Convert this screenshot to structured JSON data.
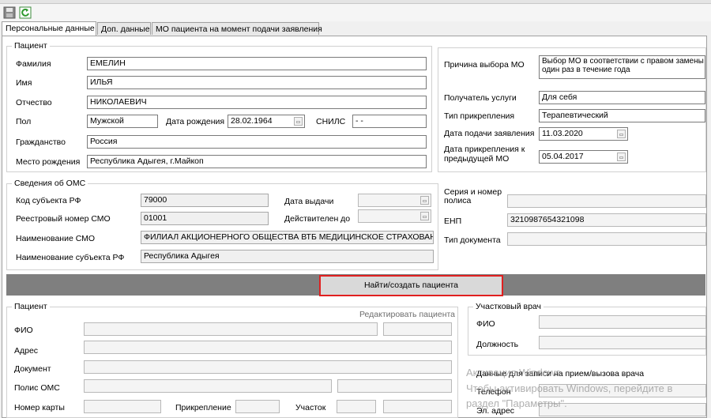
{
  "toolbar": {
    "save_icon": "save-icon",
    "refresh_icon": "refresh-icon"
  },
  "tabs": [
    "Персональные данные",
    "Доп. данные",
    "МО пациента на момент подачи заявления"
  ],
  "patient": {
    "legend": "Пациент",
    "surname_label": "Фамилия",
    "surname": "ЕМЕЛИН",
    "name_label": "Имя",
    "name": "ИЛЬЯ",
    "patronymic_label": "Отчество",
    "patronymic": "НИКОЛАЕВИЧ",
    "sex_label": "Пол",
    "sex": "Мужской",
    "dob_label": "Дата рождения",
    "dob": "28.02.1964",
    "snils_label": "СНИЛС",
    "snils": "-  -",
    "citizenship_label": "Гражданство",
    "citizenship": "Россия",
    "birthplace_label": "Место рождения",
    "birthplace": "Республика Адыгея, г.Майкоп"
  },
  "mo": {
    "reason_label": "Причина выбора МО",
    "reason": "Выбор МО в соответствии с правом замены один раз в течение года",
    "recipient_label": "Получатель услуги",
    "recipient": "Для себя",
    "attach_type_label": "Тип прикрепления",
    "attach_type": "Терапевтический",
    "app_date_label": "Дата подачи заявления",
    "app_date": "11.03.2020",
    "prev_attach_label": "Дата прикрепления к предыдущей МО",
    "prev_attach": "05.04.2017"
  },
  "oms": {
    "legend": "Сведения об ОМС",
    "subject_code_label": "Код субъекта РФ",
    "subject_code": "79000",
    "smo_reg_label": "Реестровый номер СМО",
    "smo_reg": "01001",
    "smo_name_label": "Наименование СМО",
    "smo_name": "ФИЛИАЛ АКЦИОНЕРНОГО ОБЩЕСТВА ВТБ МЕДИЦИНСКОЕ СТРАХОВАНИЕ",
    "subject_name_label": "Наименование субъекта РФ",
    "subject_name": "Республика Адыгея",
    "issue_date_label": "Дата выдачи",
    "valid_until_label": "Действителен до",
    "series_label": "Серия и номер полиса",
    "enp_label": "ЕНП",
    "enp": "3210987654321098",
    "doc_type_label": "Тип документа"
  },
  "find_button": "Найти/создать пациента",
  "patient2": {
    "legend": "Пациент",
    "edit_link": "Редактировать пациента",
    "fio_label": "ФИО",
    "address_label": "Адрес",
    "document_label": "Документ",
    "policy_label": "Полис ОМС",
    "card_label": "Номер карты",
    "attach_label": "Прикрепление",
    "district_label": "Участок"
  },
  "doctor": {
    "legend": "Участковый врач",
    "fio_label": "ФИО",
    "position_label": "Должность",
    "appointment_label": "Данные для записи на прием/вызова врача",
    "phone_label": "Телефон",
    "email_label": "Эл. адрес"
  },
  "watermark": {
    "line1": "Активация Windows",
    "line2": "Чтобы активировать Windows, перейдите в",
    "line3": "раздел \"Параметры\"."
  }
}
